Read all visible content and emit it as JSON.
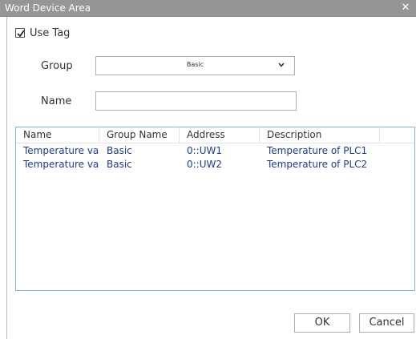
{
  "window": {
    "title": "Word Device Area",
    "close_glyph": "✕"
  },
  "form": {
    "use_tag": {
      "label": "Use Tag",
      "checked": true
    },
    "group_label": "Group",
    "group_value": "Basic",
    "name_label": "Name",
    "name_value": "",
    "name_placeholder": ""
  },
  "table": {
    "columns": [
      "Name",
      "Group Name",
      "Address",
      "Description"
    ],
    "rows": [
      {
        "name": "Temperature va",
        "group": "Basic",
        "address": "0::UW1",
        "description": "Temperature of PLC1"
      },
      {
        "name": "Temperature va",
        "group": "Basic",
        "address": "0::UW2",
        "description": "Temperature of PLC2"
      }
    ]
  },
  "buttons": {
    "ok": "OK",
    "cancel": "Cancel"
  },
  "colors": {
    "titlebar": "#969696",
    "row_text": "#1a3a8c",
    "table_border": "#7fb4dc"
  }
}
